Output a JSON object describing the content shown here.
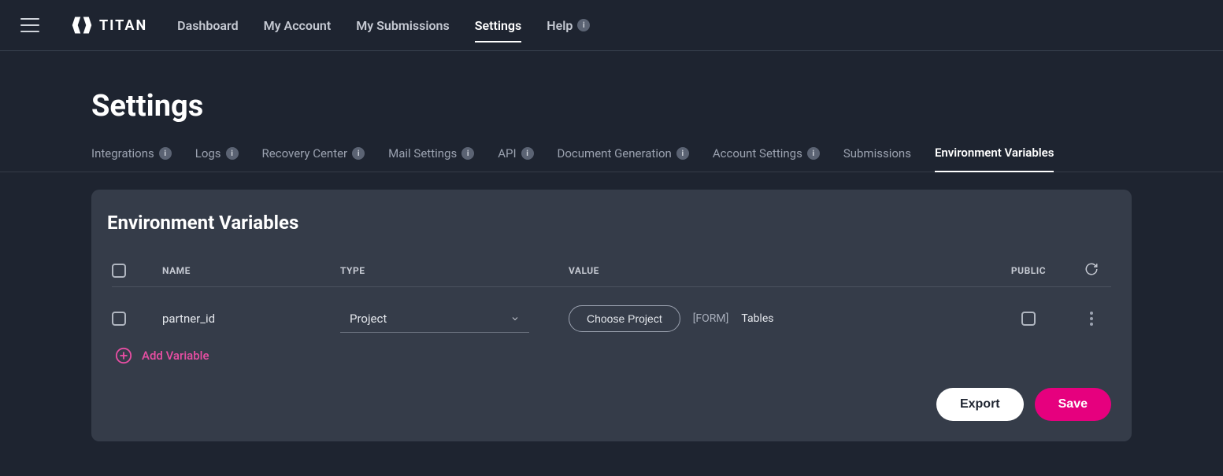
{
  "brand": {
    "name": "TITAN"
  },
  "topnav": {
    "items": [
      {
        "label": "Dashboard",
        "active": false,
        "badge": null
      },
      {
        "label": "My Account",
        "active": false,
        "badge": null
      },
      {
        "label": "My Submissions",
        "active": false,
        "badge": null
      },
      {
        "label": "Settings",
        "active": true,
        "badge": null
      },
      {
        "label": "Help",
        "active": false,
        "badge": "i"
      }
    ]
  },
  "page": {
    "title": "Settings"
  },
  "subtabs": [
    {
      "label": "Integrations",
      "badge": "i",
      "active": false
    },
    {
      "label": "Logs",
      "badge": "i",
      "active": false
    },
    {
      "label": "Recovery Center",
      "badge": "i",
      "active": false
    },
    {
      "label": "Mail Settings",
      "badge": "i",
      "active": false
    },
    {
      "label": "API",
      "badge": "i",
      "active": false
    },
    {
      "label": "Document Generation",
      "badge": "i",
      "active": false
    },
    {
      "label": "Account Settings",
      "badge": "i",
      "active": false
    },
    {
      "label": "Submissions",
      "badge": null,
      "active": false
    },
    {
      "label": "Environment Variables",
      "badge": null,
      "active": true
    }
  ],
  "panel": {
    "title": "Environment Variables",
    "columns": {
      "name": "NAME",
      "type": "TYPE",
      "value": "VALUE",
      "public": "PUBLIC"
    },
    "rows": [
      {
        "name": "partner_id",
        "type": "Project",
        "choose_label": "Choose Project",
        "form_tag": "[FORM]",
        "form_name": "Tables"
      }
    ],
    "add_label": "Add Variable",
    "buttons": {
      "export": "Export",
      "save": "Save"
    }
  }
}
